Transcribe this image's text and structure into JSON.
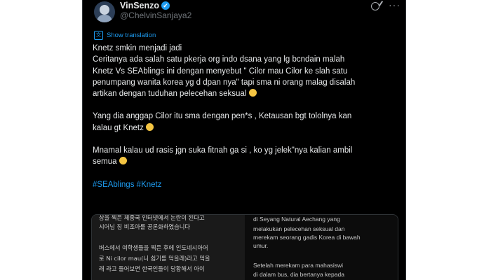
{
  "author": {
    "display_name": "VinSenzo",
    "verified_mark": "✔",
    "handle": "@ChelvinSanjaya2"
  },
  "icons": {
    "grok": "grok-icon",
    "more": "more-icon",
    "more_glyph": "···",
    "translate": "translate-icon",
    "translate_glyph": "文"
  },
  "translate_link": "Show translation",
  "tweet": {
    "lines": {
      "l1": "Knetz smkin menjadi jadi",
      "l2": "Ceritanya  ada salah satu pkerja org indo dsana yang lg bcndain malah",
      "l3": "Knetz Vs SEAblings ini dengan menyebut \" Cilor mau Cilor ke slah satu",
      "l4": "penumpang wanita korea yg d dpan nya\" tapi sma ni orang malag disalah",
      "l5": "artikan  dengan tuduhan pelecehan seksual",
      "l6": "Yang dia anggap Cilor itu sma dengan pen*s , Ketausan bgt tololnya kan",
      "l7": "kalau gt Knetz",
      "l8": "Mnamal kalau ud rasis jgn suka fitnah ga si , ko yg jelek\"nya kalian ambil",
      "l9": "semua"
    },
    "hashtags": [
      "#SEAblings",
      "#Knetz"
    ]
  },
  "media": {
    "left_lines": [
      "상을 찍은 체중국 인터넷에서 논란이 된다고",
      "시어님 징 비조아를 공론화하였습니다",
      "버스에서 여학생들을 찍은 후에 인도네시아어",
      "로 Ni cilor mau(니 쉽기를 먹을래)라고 먹을",
      "래 라고 들어보면 한국인들이 당황해서 아이"
    ],
    "right_lines": [
      "di Seyang Natural Aechang yang",
      "melakukan pelecehan seksual dan",
      "merekam seorang gadis Korea di bawah",
      "umur.",
      "Setelah merekam para mahasiswi",
      "di dalam bus, dia bertanya kepada"
    ]
  },
  "colors": {
    "background": "#000000",
    "text": "#e7e9ea",
    "muted": "#71767b",
    "accent": "#1d9bf0"
  }
}
